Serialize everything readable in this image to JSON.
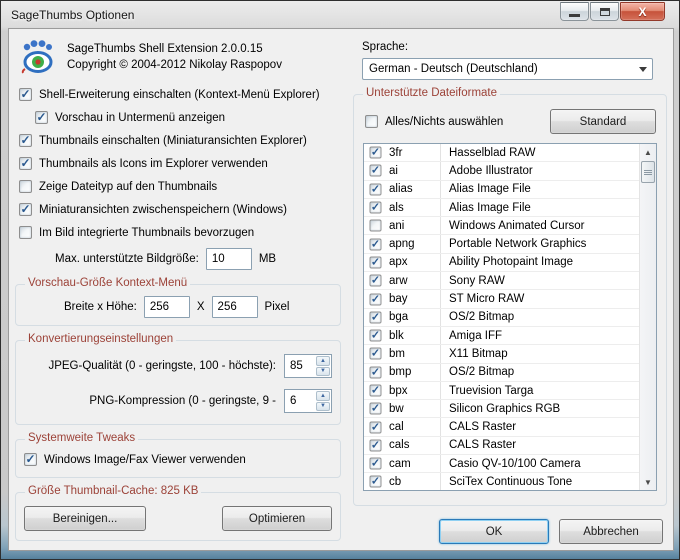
{
  "titlebar": {
    "title": "SageThumbs Optionen"
  },
  "header": {
    "product": "SageThumbs Shell Extension 2.0.0.15",
    "copyright": "Copyright © 2004-2012 Nikolay Raspopov"
  },
  "options": {
    "checkboxes": [
      {
        "label": "Shell-Erweiterung einschalten (Kontext-Menü Explorer)",
        "checked": true,
        "indent": false
      },
      {
        "label": "Vorschau in Untermenü anzeigen",
        "checked": true,
        "indent": true
      },
      {
        "label": "Thumbnails einschalten (Miniaturansichten Explorer)",
        "checked": true,
        "indent": false
      },
      {
        "label": "Thumbnails als Icons im Explorer verwenden",
        "checked": true,
        "indent": false
      },
      {
        "label": "Zeige Dateityp auf den Thumbnails",
        "checked": false,
        "indent": false
      },
      {
        "label": "Miniaturansichten zwischenspeichern (Windows)",
        "checked": true,
        "indent": false
      },
      {
        "label": "Im Bild integrierte Thumbnails bevorzugen",
        "checked": false,
        "indent": false
      }
    ],
    "max_image_size": {
      "label": "Max. unterstützte Bildgröße:",
      "value": "10",
      "unit": "MB"
    }
  },
  "preview_size_group": {
    "title": "Vorschau-Größe Kontext-Menü",
    "label": "Breite x Höhe:",
    "width_value": "256",
    "separator": "X",
    "height_value": "256",
    "unit": "Pixel"
  },
  "conversion_group": {
    "title": "Konvertierungseinstellungen",
    "jpeg_label": "JPEG-Qualität (0 - geringste, 100 - höchste):",
    "jpeg_value": "85",
    "png_label": "PNG-Kompression (0 - geringste, 9 -",
    "png_value": "6"
  },
  "tweaks_group": {
    "title": "Systemweite Tweaks",
    "checkbox_label": "Windows Image/Fax Viewer verwenden",
    "checked": true
  },
  "cache_group": {
    "title": "Größe Thumbnail-Cache: 825 KB",
    "clean_button": "Bereinigen...",
    "optimize_button": "Optimieren"
  },
  "language": {
    "label": "Sprache:",
    "selected": "German - Deutsch (Deutschland)"
  },
  "formats_group": {
    "title": "Unterstützte Dateiformate",
    "select_all_label": "Alles/Nichts auswählen",
    "select_all_checked": false,
    "standard_button": "Standard",
    "formats": [
      {
        "ext": "3fr",
        "desc": "Hasselblad RAW",
        "checked": true
      },
      {
        "ext": "ai",
        "desc": "Adobe Illustrator",
        "checked": true
      },
      {
        "ext": "alias",
        "desc": "Alias Image File",
        "checked": true
      },
      {
        "ext": "als",
        "desc": "Alias Image File",
        "checked": true
      },
      {
        "ext": "ani",
        "desc": "Windows Animated Cursor",
        "checked": false
      },
      {
        "ext": "apng",
        "desc": "Portable Network Graphics",
        "checked": true
      },
      {
        "ext": "apx",
        "desc": "Ability Photopaint Image",
        "checked": true
      },
      {
        "ext": "arw",
        "desc": "Sony RAW",
        "checked": true
      },
      {
        "ext": "bay",
        "desc": "ST Micro RAW",
        "checked": true
      },
      {
        "ext": "bga",
        "desc": "OS/2 Bitmap",
        "checked": true
      },
      {
        "ext": "blk",
        "desc": "Amiga IFF",
        "checked": true
      },
      {
        "ext": "bm",
        "desc": "X11 Bitmap",
        "checked": true
      },
      {
        "ext": "bmp",
        "desc": "OS/2 Bitmap",
        "checked": true
      },
      {
        "ext": "bpx",
        "desc": "Truevision Targa",
        "checked": true
      },
      {
        "ext": "bw",
        "desc": "Silicon Graphics RGB",
        "checked": true
      },
      {
        "ext": "cal",
        "desc": "CALS Raster",
        "checked": true
      },
      {
        "ext": "cals",
        "desc": "CALS Raster",
        "checked": true
      },
      {
        "ext": "cam",
        "desc": "Casio QV-10/100 Camera",
        "checked": true
      },
      {
        "ext": "cb",
        "desc": "SciTex Continuous Tone",
        "checked": true
      }
    ]
  },
  "footer": {
    "ok_button": "OK",
    "cancel_button": "Abbrechen"
  },
  "colors": {
    "group_title": "#9c4238",
    "focus_blue": "#2a7ab8",
    "dialog_bg": "#f0f0f0",
    "checkmark": "#2a598f"
  }
}
